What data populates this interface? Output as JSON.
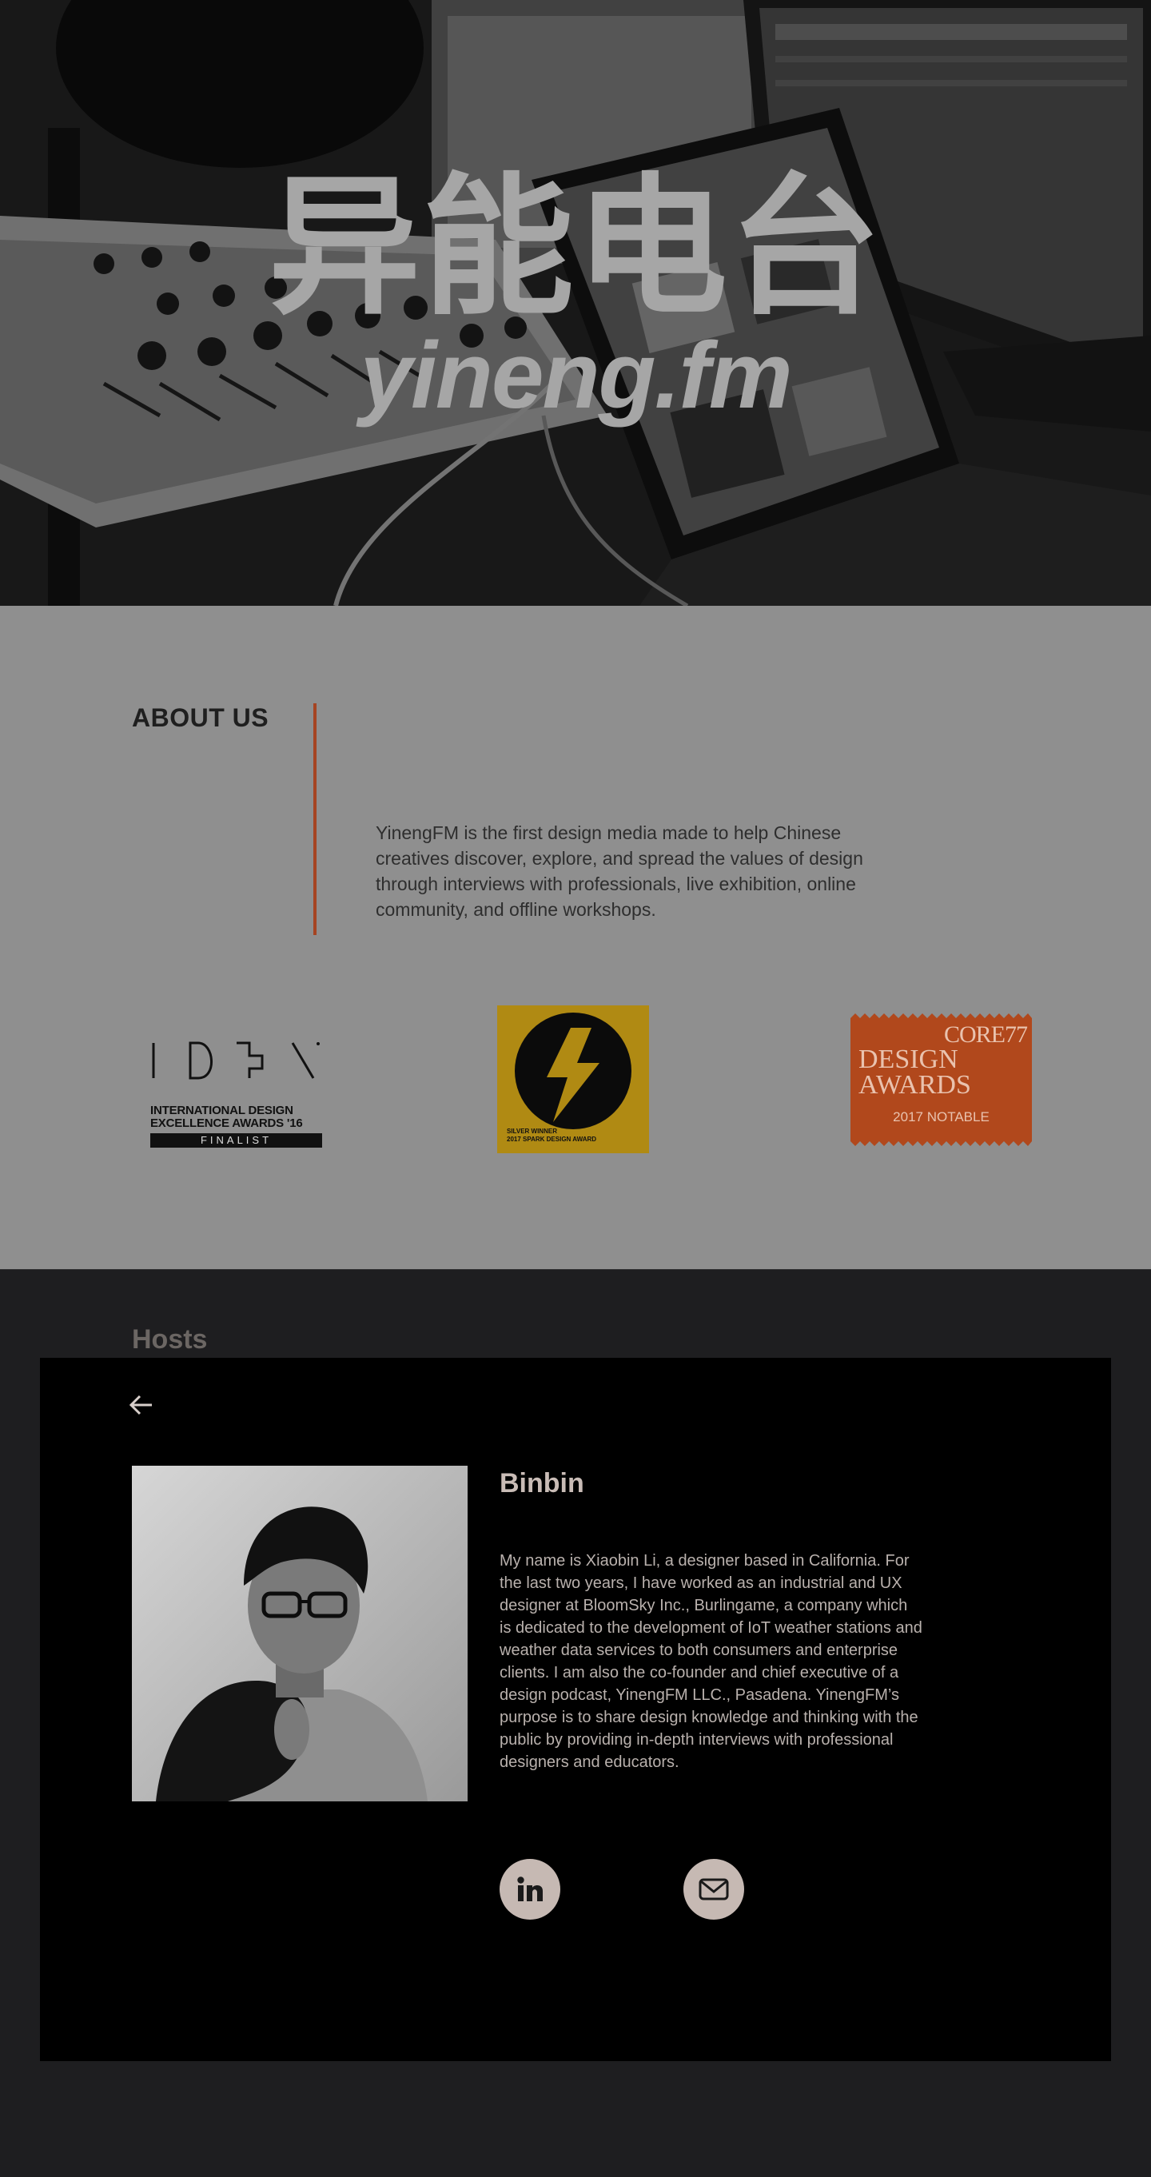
{
  "hero": {
    "title_cn": "异能电台",
    "title_en": "yineng.fm"
  },
  "about": {
    "heading": "ABOUT US",
    "description": "YinengFM is the first design media made to help Chinese creatives discover, explore, and spread the values of design through interviews with professionals, live exhibition, online community, and offline workshops.",
    "awards": [
      {
        "name": "IDEA",
        "line1": "INTERNATIONAL DESIGN",
        "line2": "EXCELLENCE AWARDS",
        "year": "'16",
        "badge": "FINALIST"
      },
      {
        "name": "Spark",
        "line1": "SILVER WINNER",
        "line2": "2017 SPARK DESIGN AWARD"
      },
      {
        "name": "Core77",
        "line1": "CORE77",
        "line2": "DESIGN",
        "line3": "AWARDS",
        "line4": "2017 NOTABLE"
      }
    ]
  },
  "hosts": {
    "heading": "Hosts",
    "host": {
      "name": "Binbin",
      "bio": "My name is Xiaobin Li, a designer based in California. For the last two years, I have worked as an industrial and UX designer at BloomSky Inc., Burlingame, a company which is dedicated to the development of IoT weather stations and weather data services to both consumers and enterprise clients. I am also the co-founder and chief executive of a design podcast, YinengFM LLC., Pasadena. YinengFM’s purpose is to share design knowledge and thinking with the public by providing in-depth interviews with professional designers and educators."
    },
    "icons": {
      "back": "arrow-left-icon",
      "linkedin": "linkedin-icon",
      "email": "mail-icon"
    }
  },
  "colors": {
    "accent": "#a64422",
    "about_bg": "#8f8f8f",
    "hosts_bg": "#1e1e20",
    "card_bg": "#000000",
    "social_bg": "#c6b9b3"
  }
}
